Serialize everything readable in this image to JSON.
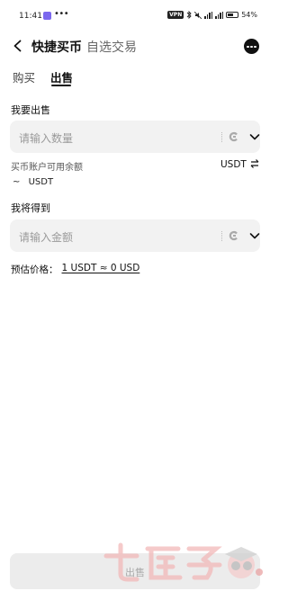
{
  "status_bar": {
    "time": "11:41",
    "dots": "•••",
    "vpn": "VPN",
    "battery": "54%"
  },
  "header": {
    "title": "快捷买币",
    "secondary_tab": "自选交易"
  },
  "tabs": {
    "buy": "购买",
    "sell": "出售"
  },
  "sell_section": {
    "label": "我要出售",
    "input_placeholder": "请输入数量"
  },
  "balance": {
    "label": "买币账户可用余额",
    "currency": "USDT",
    "approx_prefix": "~",
    "approx_unit": "USDT"
  },
  "receive_section": {
    "label": "我将得到",
    "input_placeholder": "请输入金额"
  },
  "estimate": {
    "label": "预估价格：",
    "value": "1 USDT ≈ 0 USD"
  },
  "submit": {
    "label": "出售"
  },
  "colors": {
    "background": "#ffffff",
    "input_bg": "#f2f2f2",
    "primary_text": "#111111",
    "placeholder": "#9a9a9a",
    "disabled_button": "#ececec"
  },
  "icons": {
    "back": "back-arrow-icon",
    "more": "more-icon",
    "coin": "coin-icon",
    "chevron": "chevron-down-icon",
    "swap": "swap-icon"
  }
}
